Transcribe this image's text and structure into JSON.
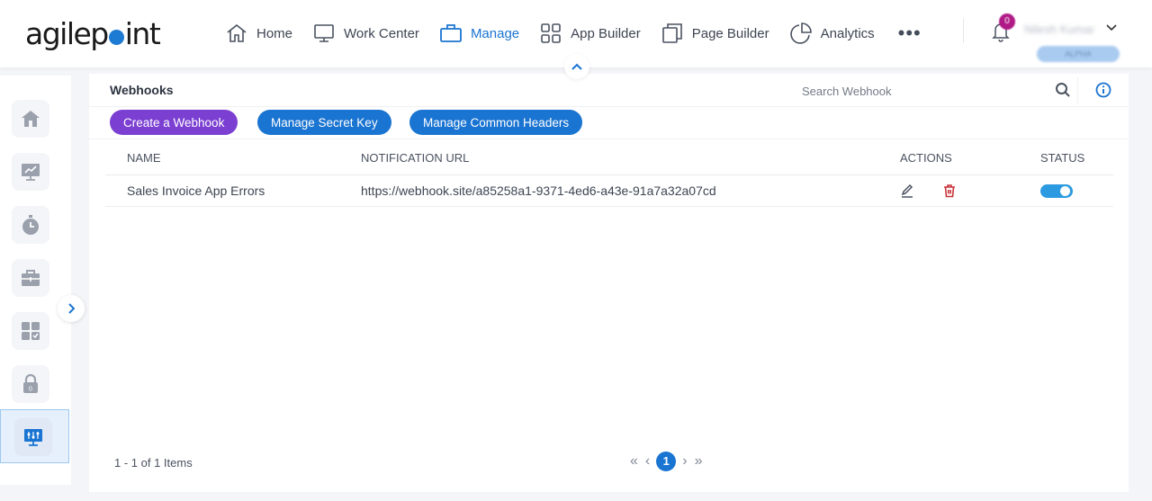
{
  "header": {
    "logo": {
      "prefix": "agilep",
      "suffix": "int"
    },
    "nav": [
      {
        "label": "Home",
        "icon": "home-icon",
        "active": false
      },
      {
        "label": "Work Center",
        "icon": "monitor-icon",
        "active": false
      },
      {
        "label": "Manage",
        "icon": "briefcase-icon",
        "active": true
      },
      {
        "label": "App Builder",
        "icon": "grid-icon",
        "active": false
      },
      {
        "label": "Page Builder",
        "icon": "pages-icon",
        "active": false
      },
      {
        "label": "Analytics",
        "icon": "pie-chart-icon",
        "active": false
      }
    ],
    "more_label": "•••",
    "notification_count": "0",
    "user_name": "Nilesh Kumar",
    "user_chevron": "⌄",
    "environment_badge": "ALPHA"
  },
  "sidebar": {
    "items": [
      {
        "name": "home",
        "icon": "home-icon",
        "active": false
      },
      {
        "name": "monitoring",
        "icon": "chart-monitor-icon",
        "active": false
      },
      {
        "name": "timer",
        "icon": "stopwatch-icon",
        "active": false
      },
      {
        "name": "tools",
        "icon": "toolbox-icon",
        "active": false
      },
      {
        "name": "dashboard",
        "icon": "dashboard-check-icon",
        "active": false
      },
      {
        "name": "security",
        "icon": "lock-icon",
        "active": false
      },
      {
        "name": "integration-settings",
        "icon": "settings-monitor-icon",
        "active": true
      }
    ]
  },
  "page": {
    "title": "Webhooks",
    "search_placeholder": "Search Webhook",
    "buttons": {
      "create": "Create a Webhook",
      "secret_key": "Manage Secret Key",
      "common_headers": "Manage Common Headers"
    },
    "colors": {
      "primary": "#1a74d1",
      "create": "#7b3fd2",
      "delete": "#c8323a",
      "toggle_on": "#2b9ae0"
    },
    "table": {
      "columns": [
        "NAME",
        "NOTIFICATION URL",
        "ACTIONS",
        "STATUS"
      ],
      "rows": [
        {
          "name": "Sales Invoice App Errors",
          "url": "https://webhook.site/a85258a1-9371-4ed6-a43e-91a7a32a07cd",
          "status_enabled": true
        }
      ]
    },
    "pagination": {
      "summary": "1 - 1 of 1 Items",
      "current_page": "1",
      "first": "«",
      "prev": "‹",
      "next": "›",
      "last": "»"
    }
  }
}
